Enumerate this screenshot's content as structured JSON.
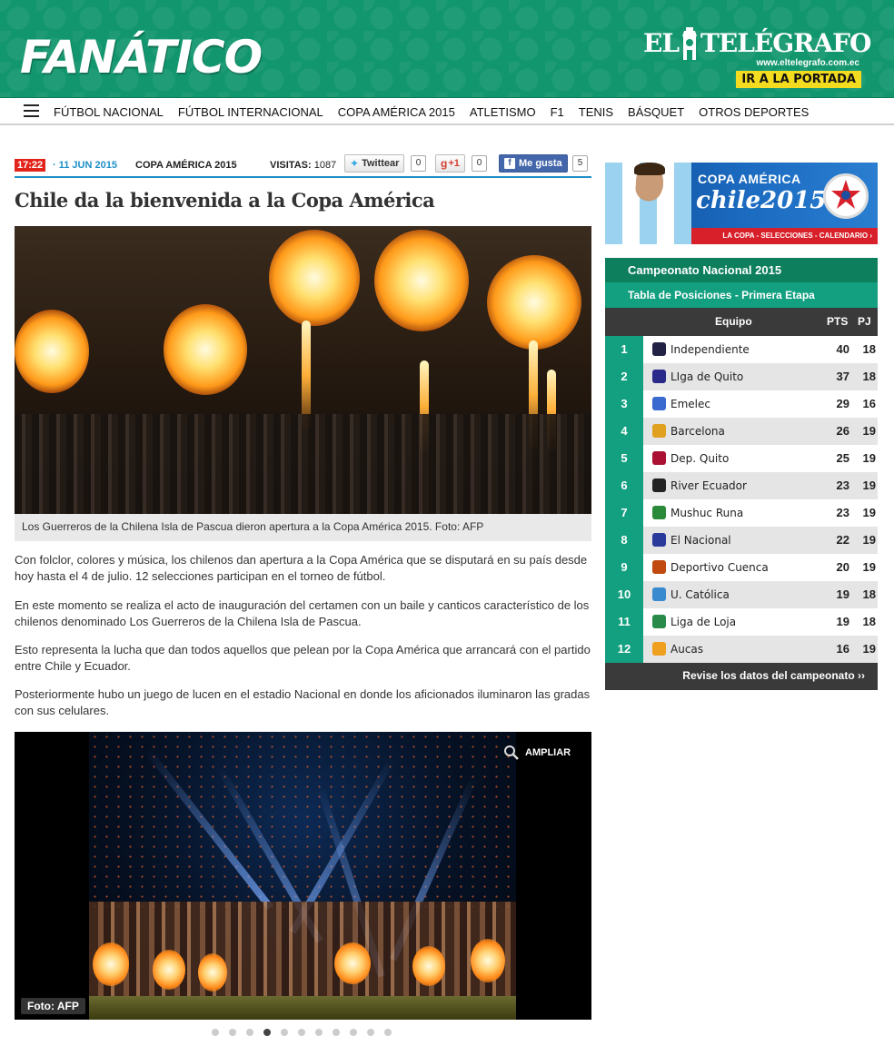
{
  "header": {
    "logo": "FANÁTICO",
    "partner_name_left": "EL",
    "partner_name_right": "TELÉGRAFO",
    "partner_url": "www.eltelegrafo.com.ec",
    "portada_button": "IR A LA PORTADA",
    "menu_icon": "hamburger-menu-icon",
    "brand_color": "#12966d"
  },
  "nav": {
    "items": [
      "FÚTBOL NACIONAL",
      "FÚTBOL INTERNACIONAL",
      "COPA AMÉRICA 2015",
      "ATLETISMO",
      "F1",
      "TENIS",
      "BÁSQUET",
      "OTROS DEPORTES"
    ]
  },
  "article": {
    "time": "17:22",
    "date": "· 11 JUN 2015",
    "section": "COPA AMÉRICA 2015",
    "visits_label": "VISITAS:",
    "visits_value": "1087",
    "twitter_label": "Twittear",
    "twitter_count": "0",
    "gplus_label": "+1",
    "gplus_count": "0",
    "facebook_label": "Me gusta",
    "facebook_count": "5",
    "title": "Chile da la bienvenida a la Copa América",
    "caption": "Los Guerreros de la Chilena Isla de Pascua dieron apertura a la Copa América 2015. Foto: AFP",
    "paragraphs": [
      "Con folclor, colores y música, los chilenos dan apertura a la Copa América que se disputará en su país desde hoy hasta el 4 de julio. 12 selecciones participan en el torneo de fútbol.",
      "En este momento se realiza el acto de inauguración del certamen con un baile y canticos característico de los chilenos denominado Los Guerreros de la Chilena Isla de Pascua.",
      "Esto representa la lucha que dan todos aquellos que pelean por la Copa América que arrancará con el partido entre Chile y Ecuador.",
      "Posteriormente hubo un juego de lucen en el estadio Nacional en donde los aficionados iluminaron las gradas con sus celulares."
    ]
  },
  "gallery": {
    "zoom_label": "AMPLIAR",
    "credit": "Foto: AFP",
    "total_slides": 11,
    "active_slide": 4
  },
  "sidebar": {
    "banner": {
      "title": "COPA AMÉRICA",
      "subtitle": "chile2015",
      "strip": "LA COPA - SELECCIONES - CALENDARIO ›"
    },
    "standings": {
      "title": "Campeonato Nacional 2015",
      "subtitle": "Tabla de Posiciones - Primera Etapa",
      "col_team": "Equipo",
      "col_pts": "PTS",
      "col_pj": "PJ",
      "rows": [
        {
          "pos": "1",
          "team": "Independiente",
          "pts": "40",
          "pj": "18",
          "color": "#222244"
        },
        {
          "pos": "2",
          "team": "LIga de Quito",
          "pts": "37",
          "pj": "18",
          "color": "#2a2a8a"
        },
        {
          "pos": "3",
          "team": "Emelec",
          "pts": "29",
          "pj": "16",
          "color": "#3a6ad0"
        },
        {
          "pos": "4",
          "team": "Barcelona",
          "pts": "26",
          "pj": "19",
          "color": "#e0a020"
        },
        {
          "pos": "5",
          "team": "Dep. Quito",
          "pts": "25",
          "pj": "19",
          "color": "#aa1133"
        },
        {
          "pos": "6",
          "team": "River Ecuador",
          "pts": "23",
          "pj": "19",
          "color": "#222222"
        },
        {
          "pos": "7",
          "team": "Mushuc Runa",
          "pts": "23",
          "pj": "19",
          "color": "#2a8a3a"
        },
        {
          "pos": "8",
          "team": "El Nacional",
          "pts": "22",
          "pj": "19",
          "color": "#2a3a9a"
        },
        {
          "pos": "9",
          "team": "Deportivo Cuenca",
          "pts": "20",
          "pj": "19",
          "color": "#c04a10"
        },
        {
          "pos": "10",
          "team": "U. Católica",
          "pts": "19",
          "pj": "18",
          "color": "#3a8ad0"
        },
        {
          "pos": "11",
          "team": "Liga de Loja",
          "pts": "19",
          "pj": "18",
          "color": "#2a8a4a"
        },
        {
          "pos": "12",
          "team": "Aucas",
          "pts": "16",
          "pj": "19",
          "color": "#f0a020"
        }
      ],
      "footer": "Revise los datos del campeonato ››"
    }
  }
}
